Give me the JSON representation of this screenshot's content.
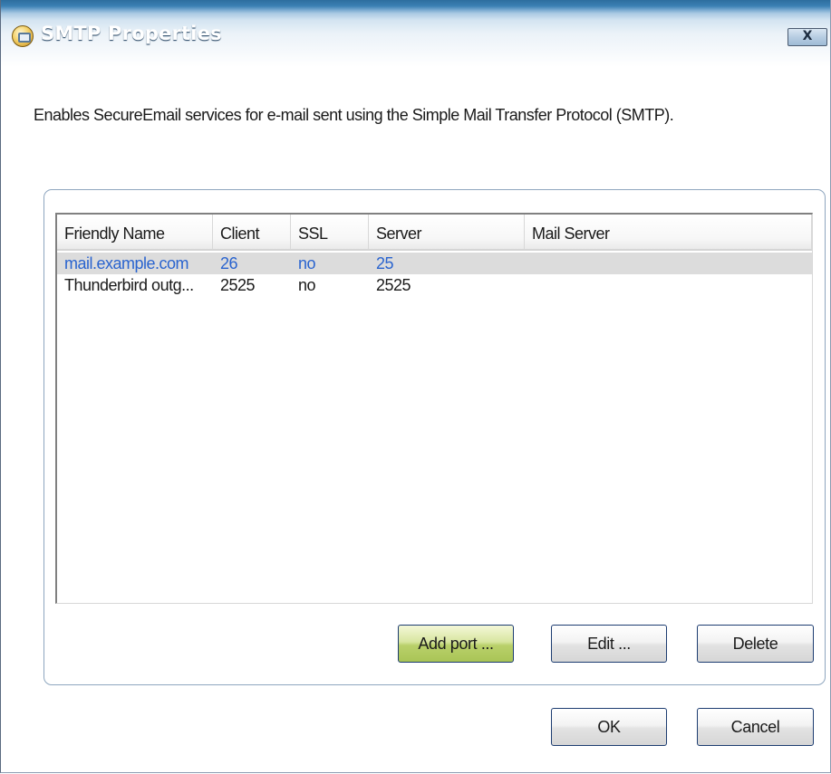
{
  "window": {
    "title": "SMTP Properties",
    "close_label": "X"
  },
  "description": "Enables SecureEmail services for e-mail sent using the Simple Mail Transfer Protocol (SMTP).",
  "table": {
    "columns": [
      "Friendly Name",
      "Client",
      "SSL",
      "Server",
      "Mail Server"
    ],
    "rows": [
      {
        "friendly_name": "mail.example.com",
        "client": "26",
        "ssl": "no",
        "server": "25",
        "mail_server": "",
        "selected": true
      },
      {
        "friendly_name": "Thunderbird outg...",
        "client": "2525",
        "ssl": "no",
        "server": "2525",
        "mail_server": "",
        "selected": false
      }
    ]
  },
  "buttons": {
    "add_port": "Add port ...",
    "edit": "Edit ...",
    "delete": "Delete",
    "ok": "OK",
    "cancel": "Cancel"
  },
  "colors": {
    "selected_row_text": "#2a64cf",
    "selected_row_bg": "#dcdcdc",
    "accent_button": "#b9d06a",
    "title_bar": "#3b80b4"
  }
}
